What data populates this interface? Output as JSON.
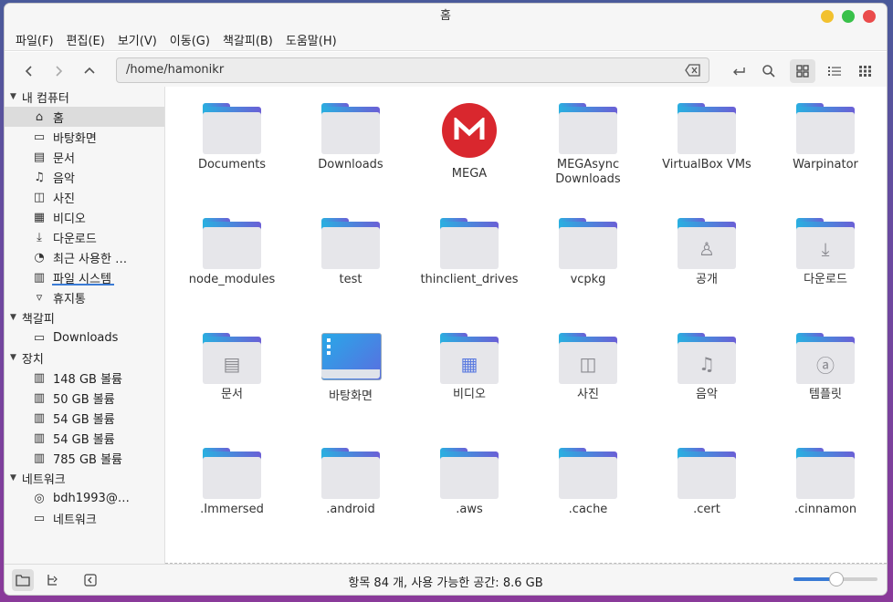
{
  "window": {
    "title": "홈"
  },
  "menu": [
    "파일(F)",
    "편집(E)",
    "보기(V)",
    "이동(G)",
    "책갈피(B)",
    "도움말(H)"
  ],
  "path": {
    "value": "/home/hamonikr"
  },
  "sidebar": {
    "sections": [
      {
        "label": "내 컴퓨터",
        "items": [
          {
            "label": "홈",
            "icon": "home-icon",
            "glyph": "⌂"
          },
          {
            "label": "바탕화면",
            "icon": "desktop-icon",
            "glyph": "▭"
          },
          {
            "label": "문서",
            "icon": "document-icon",
            "glyph": "▤"
          },
          {
            "label": "음악",
            "icon": "music-icon",
            "glyph": "♫"
          },
          {
            "label": "사진",
            "icon": "picture-icon",
            "glyph": "◫"
          },
          {
            "label": "비디오",
            "icon": "video-icon",
            "glyph": "▦"
          },
          {
            "label": "다운로드",
            "icon": "download-icon",
            "glyph": "⤓"
          },
          {
            "label": "최근 사용한 …",
            "icon": "recent-icon",
            "glyph": "◔"
          },
          {
            "label": "파일 시스템",
            "icon": "drive-icon",
            "glyph": "▥"
          },
          {
            "label": "휴지통",
            "icon": "trash-icon",
            "glyph": "▿"
          }
        ]
      },
      {
        "label": "책갈피",
        "items": [
          {
            "label": "Downloads",
            "icon": "folder-icon",
            "glyph": "▭"
          }
        ]
      },
      {
        "label": "장치",
        "items": [
          {
            "label": "148 GB 볼륨",
            "icon": "drive-icon",
            "glyph": "▥"
          },
          {
            "label": "50 GB 볼륨",
            "icon": "drive-icon",
            "glyph": "▥"
          },
          {
            "label": "54 GB 볼륨",
            "icon": "drive-icon",
            "glyph": "▥"
          },
          {
            "label": "54 GB 볼륨",
            "icon": "drive-icon",
            "glyph": "▥"
          },
          {
            "label": "785 GB 볼륨",
            "icon": "drive-icon",
            "glyph": "▥"
          }
        ]
      },
      {
        "label": "네트워크",
        "items": [
          {
            "label": "bdh1993@…",
            "icon": "network-share-icon",
            "glyph": "◎"
          },
          {
            "label": "네트워크",
            "icon": "network-icon",
            "glyph": "▭"
          }
        ]
      }
    ]
  },
  "files": [
    {
      "name": "Documents",
      "type": "folder"
    },
    {
      "name": "Downloads",
      "type": "folder"
    },
    {
      "name": "MEGA",
      "type": "mega"
    },
    {
      "name": "MEGAsync Downloads",
      "type": "folder"
    },
    {
      "name": "VirtualBox VMs",
      "type": "folder"
    },
    {
      "name": "Warpinator",
      "type": "folder"
    },
    {
      "name": "node_modules",
      "type": "folder"
    },
    {
      "name": "test",
      "type": "folder"
    },
    {
      "name": "thinclient_drives",
      "type": "folder"
    },
    {
      "name": "vcpkg",
      "type": "folder"
    },
    {
      "name": "공개",
      "type": "folder",
      "emblem": "person-icon",
      "glyph": "♙"
    },
    {
      "name": "다운로드",
      "type": "folder",
      "emblem": "download-icon",
      "glyph": "⤓"
    },
    {
      "name": "문서",
      "type": "folder",
      "emblem": "document-icon",
      "glyph": "▤"
    },
    {
      "name": "바탕화면",
      "type": "desktop"
    },
    {
      "name": "비디오",
      "type": "folder",
      "emblem": "film-icon",
      "glyph": "▦"
    },
    {
      "name": "사진",
      "type": "folder",
      "emblem": "picture-icon",
      "glyph": "◫"
    },
    {
      "name": "음악",
      "type": "folder",
      "emblem": "music-icon",
      "glyph": "♫"
    },
    {
      "name": "템플릿",
      "type": "folder",
      "emblem": "template-icon",
      "glyph": "ⓐ"
    },
    {
      "name": ".Immersed",
      "type": "folder"
    },
    {
      "name": ".android",
      "type": "folder"
    },
    {
      "name": ".aws",
      "type": "folder"
    },
    {
      "name": ".cache",
      "type": "folder"
    },
    {
      "name": ".cert",
      "type": "folder"
    },
    {
      "name": ".cinnamon",
      "type": "folder"
    }
  ],
  "status": {
    "text": "항목 84 개, 사용 가능한 공간: 8.6 GB"
  },
  "zoom": {
    "level": 0.5
  },
  "colors": {
    "accent": "#3a7bd5",
    "mega_red": "#d9272e",
    "close": "#ea4b4b",
    "minimize": "#f2c12e",
    "maximize": "#39c14a"
  }
}
